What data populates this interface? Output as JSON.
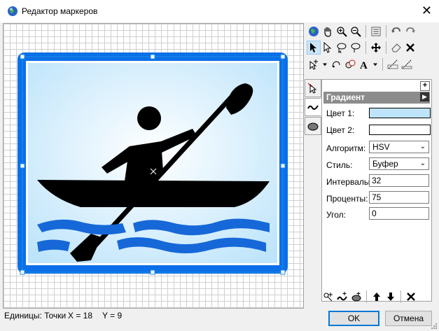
{
  "window": {
    "title": "Редактор маркеров"
  },
  "toolbar": {
    "row1": [
      "globe-icon",
      "hand-icon",
      "zoom-in-icon",
      "zoom-out-icon",
      "properties-icon",
      "undo-icon",
      "redo-icon"
    ],
    "row2": [
      "select-arrow-icon",
      "node-arrow-icon",
      "lasso-icon",
      "lasso-node-icon",
      "move-icon",
      "eraser-icon",
      "delete-icon"
    ],
    "row3": [
      "add-point-icon",
      "rotate-icon",
      "transform-icon",
      "text-icon",
      "dropdown-icon",
      "edit-line-icon",
      "edit-line-alt-icon"
    ]
  },
  "sidetabs": [
    "node-tab",
    "line-tab",
    "fill-tab"
  ],
  "panel": {
    "header": "Градиент",
    "color1_label": "Цвет 1:",
    "color1_value": "#bde4fb",
    "color2_label": "Цвет 2:",
    "color2_value": "#ffffff",
    "algorithm_label": "Алгоритм:",
    "algorithm_value": "HSV",
    "style_label": "Стиль:",
    "style_value": "Буфер",
    "intervals_label": "Интервалы:",
    "intervals_value": "32",
    "percents_label": "Проценты:",
    "percents_value": "75",
    "angle_label": "Угол:",
    "angle_value": "0"
  },
  "status": {
    "units": "Единицы: Точки",
    "x": "X = 18",
    "y": "Y = 9"
  },
  "buttons": {
    "ok": "OK",
    "cancel": "Отмена"
  },
  "colors": {
    "accent": "#0a6fe8",
    "wave": "#1668d8",
    "figure": "#000000"
  }
}
